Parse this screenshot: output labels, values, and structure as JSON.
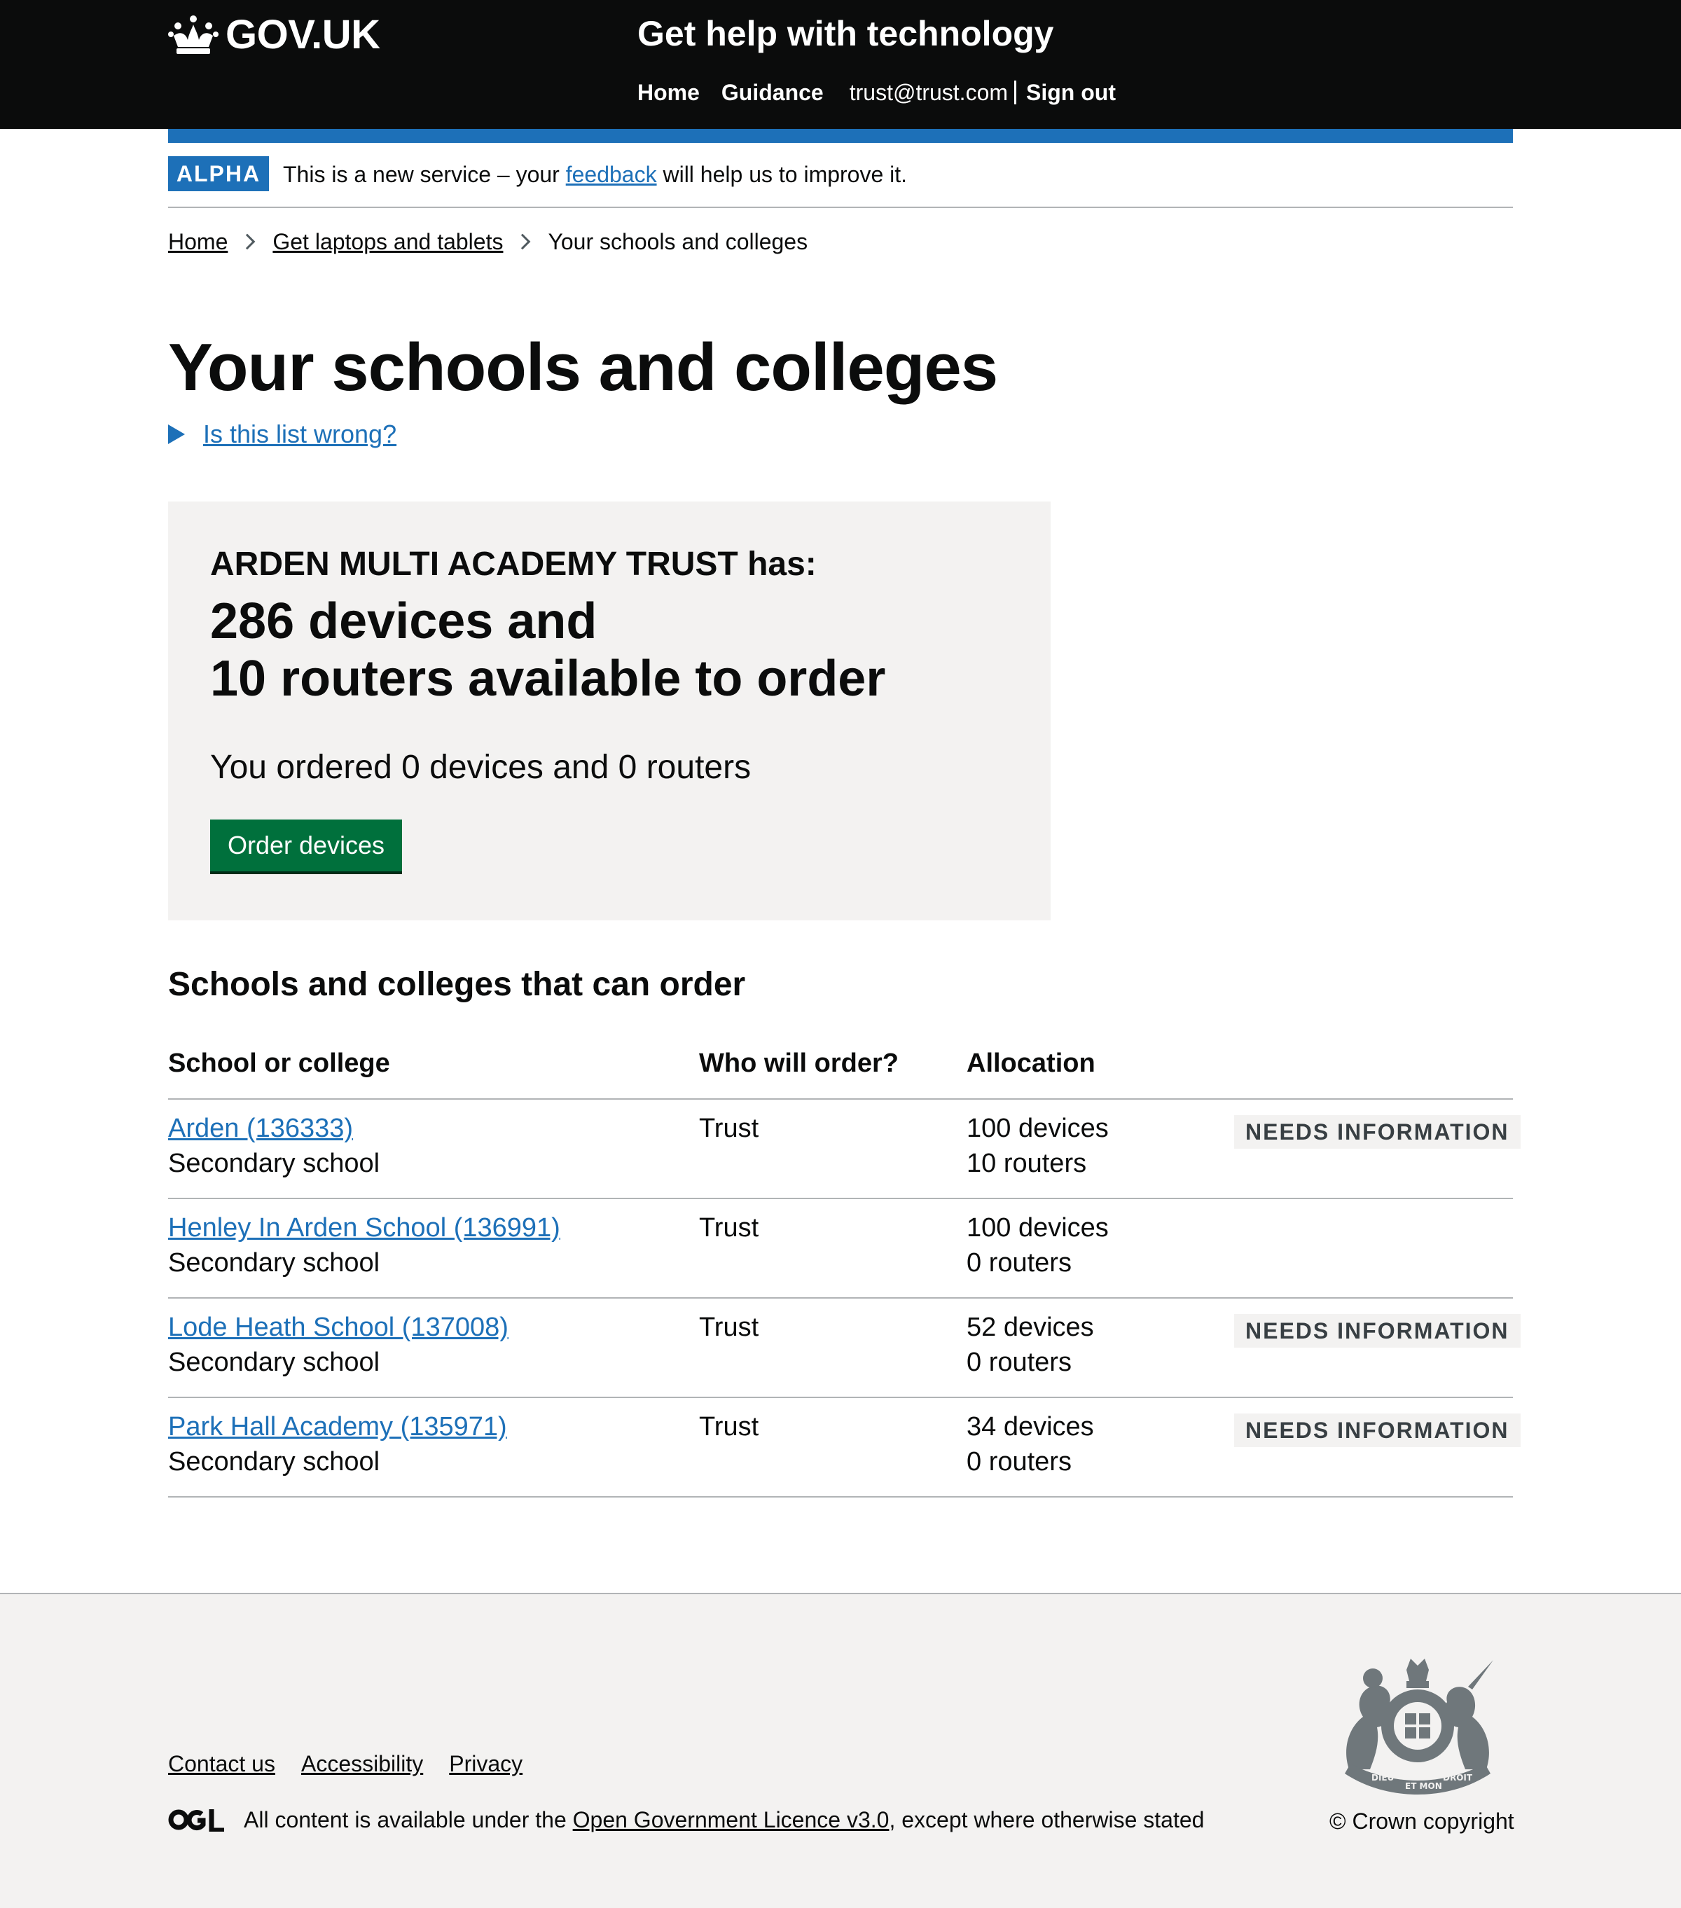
{
  "header": {
    "logo_text": "GOV.UK",
    "service_name": "Get help with technology",
    "nav": {
      "home": "Home",
      "guidance": "Guidance",
      "user_email": "trust@trust.com",
      "sign_out": "Sign out"
    }
  },
  "phase_banner": {
    "tag": "ALPHA",
    "text_before": "This is a new service – your",
    "link": "feedback",
    "text_after": "will help us to improve it."
  },
  "breadcrumbs": [
    {
      "label": "Home"
    },
    {
      "label": "Get laptops and tablets"
    },
    {
      "label": "Your schools and colleges"
    }
  ],
  "page_title": "Your schools and colleges",
  "details_summary": "Is this list wrong?",
  "panel": {
    "trust_line": "ARDEN MULTI ACADEMY TRUST has:",
    "available_line1": "286 devices and",
    "available_line2": "10 routers available to order",
    "ordered_line": "You ordered 0 devices and 0 routers",
    "button": "Order devices"
  },
  "section_heading": "Schools and colleges that can order",
  "table": {
    "headers": [
      "School or college",
      "Who will order?",
      "Allocation"
    ],
    "rows": [
      {
        "school": "Arden (136333)",
        "type": "Secondary school",
        "who": "Trust",
        "devices": "100 devices",
        "routers": "10 routers",
        "status": "NEEDS INFORMATION"
      },
      {
        "school": "Henley In Arden School (136991)",
        "type": "Secondary school",
        "who": "Trust",
        "devices": "100 devices",
        "routers": "0 routers",
        "status": ""
      },
      {
        "school": "Lode Heath School (137008)",
        "type": "Secondary school",
        "who": "Trust",
        "devices": "52 devices",
        "routers": "0 routers",
        "status": "NEEDS INFORMATION"
      },
      {
        "school": "Park Hall Academy (135971)",
        "type": "Secondary school",
        "who": "Trust",
        "devices": "34 devices",
        "routers": "0 routers",
        "status": "NEEDS INFORMATION"
      }
    ]
  },
  "footer": {
    "links": [
      "Contact us",
      "Accessibility",
      "Privacy"
    ],
    "licence_before": "All content is available under the",
    "licence_link": "Open Government Licence v3.0",
    "licence_after": ", except where otherwise stated",
    "copyright": "© Crown copyright",
    "crest_mottos": [
      "DIEU",
      "ET MON",
      "DROIT"
    ]
  },
  "colors": {
    "header_bg": "#0b0c0c",
    "link": "#1d70b8",
    "button": "#00703c",
    "panel_bg": "#f3f2f1",
    "tag_bg": "#f3f2f1",
    "tag_text": "#383f43"
  },
  "icons": [
    "crown-icon",
    "breadcrumb-chevron-icon",
    "disclosure-triangle-icon",
    "ogl-logo-icon",
    "royal-coat-of-arms-icon"
  ]
}
